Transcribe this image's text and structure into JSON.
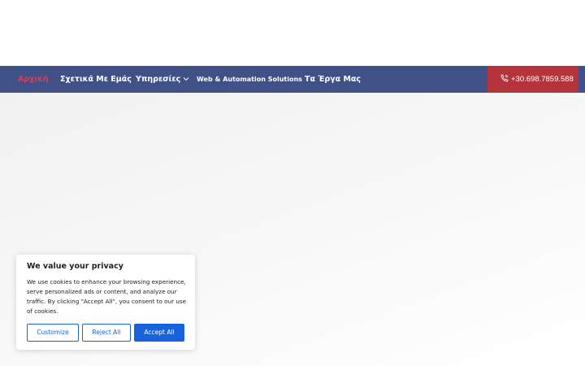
{
  "nav": {
    "items": [
      {
        "label": "Αρχική",
        "active": true
      },
      {
        "label": "Σχετικά Με Εμάς"
      },
      {
        "label": "Υπηρεσίες",
        "has_dropdown": true,
        "dropdown_icon": "chevron-down-icon"
      },
      {
        "label": "Web & Automation Solutions"
      },
      {
        "label": "Τα Έργα Μας"
      }
    ],
    "phone": {
      "label": "+30.698.7859.588",
      "icon": "phone-icon"
    }
  },
  "cookie_banner": {
    "title": "We value your privacy",
    "text": "We use cookies to enhance your browsing experience, serve personalized ads or content, and analyze our traffic. By clicking \"Accept All\", you consent to our use of cookies.",
    "customize_label": "Customize",
    "reject_label": "Reject All",
    "accept_label": "Accept All"
  },
  "colors": {
    "nav_bg": "#3f5187",
    "nav_active": "#e8384f",
    "phone_bg": "#b5343b",
    "cookie_accent": "#1863dc"
  }
}
